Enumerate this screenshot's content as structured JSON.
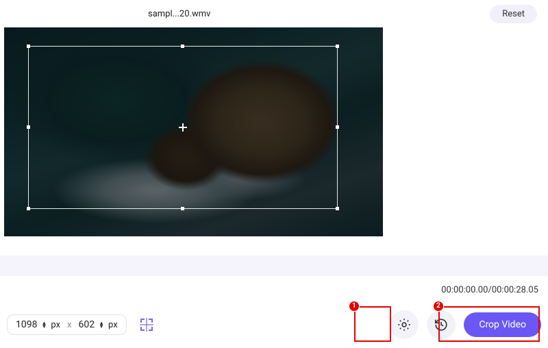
{
  "header": {
    "filename": "sampl...20.wmv",
    "reset_label": "Reset"
  },
  "dimensions": {
    "width": "1098",
    "height": "602",
    "unit": "px",
    "separator": "x"
  },
  "time": {
    "current": "00:00:00.00",
    "total": "00:00:28.05"
  },
  "actions": {
    "crop_label": "Crop Video"
  },
  "annotations": {
    "one": "1",
    "two": "2"
  }
}
